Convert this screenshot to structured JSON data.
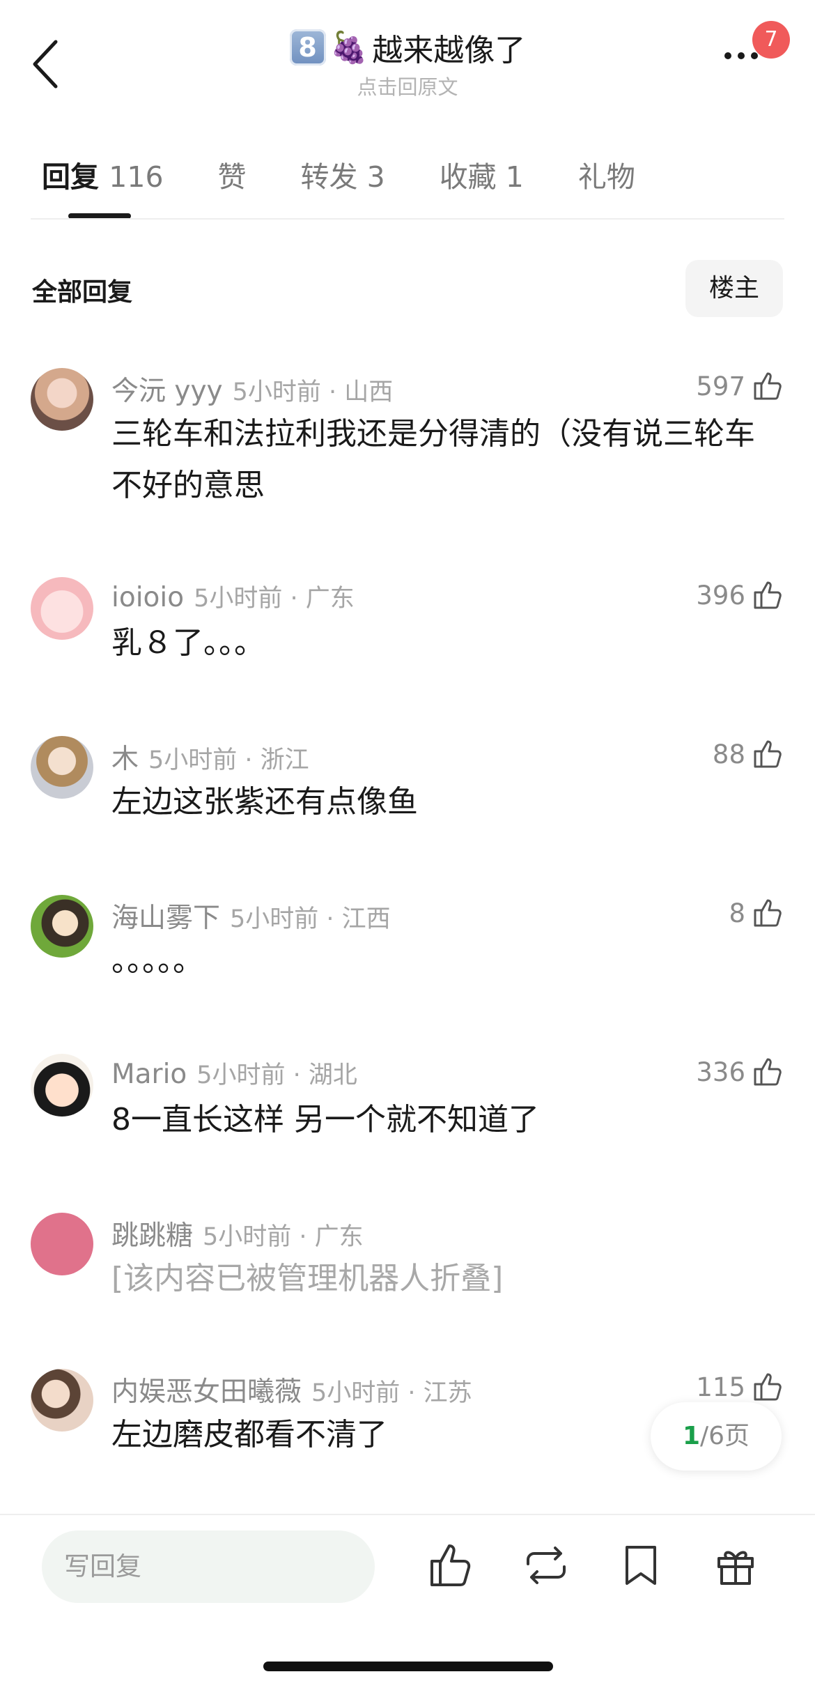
{
  "header": {
    "title_number": "8",
    "title_emoji": "🍇",
    "title_text": "越来越像了",
    "subtitle": "点击回原文",
    "notification_count": "7"
  },
  "tabs": [
    {
      "label": "回复",
      "count": "116"
    },
    {
      "label": "赞",
      "count": ""
    },
    {
      "label": "转发",
      "count": "3"
    },
    {
      "label": "收藏",
      "count": "1"
    },
    {
      "label": "礼物",
      "count": ""
    }
  ],
  "section": {
    "label": "全部回复",
    "filter_button": "楼主"
  },
  "comments": [
    {
      "user": "今沅 yyy",
      "time_location": "5小时前 · 山西",
      "likes": "597",
      "text": "三轮车和法拉利我还是分得清的（没有说三轮车不好的意思"
    },
    {
      "user": "ioioio",
      "time_location": "5小时前 · 广东",
      "likes": "396",
      "text": "乳８了。。。"
    },
    {
      "user": "木",
      "time_location": "5小时前 · 浙江",
      "likes": "88",
      "text": "左边这张紫还有点像鱼"
    },
    {
      "user": "海山雾下",
      "time_location": "5小时前 · 江西",
      "likes": "8",
      "text": "。。。。。"
    },
    {
      "user": "Mario",
      "time_location": "5小时前 · 湖北",
      "likes": "336",
      "text": "8一直长这样 另一个就不知道了"
    },
    {
      "user": "跳跳糖",
      "time_location": "5小时前 · 广东",
      "likes": "",
      "text": "[该内容已被管理机器人折叠]"
    },
    {
      "user": "内娱恶女田曦薇",
      "time_location": "5小时前 · 江苏",
      "likes": "115",
      "text": "左边磨皮都看不清了"
    }
  ],
  "pager": {
    "current": "1",
    "total_text": "/6页"
  },
  "bottom_bar": {
    "reply_placeholder": "写回复"
  },
  "colors": {
    "accent_green": "#1a9f4a",
    "badge_red": "#f05a5a"
  }
}
